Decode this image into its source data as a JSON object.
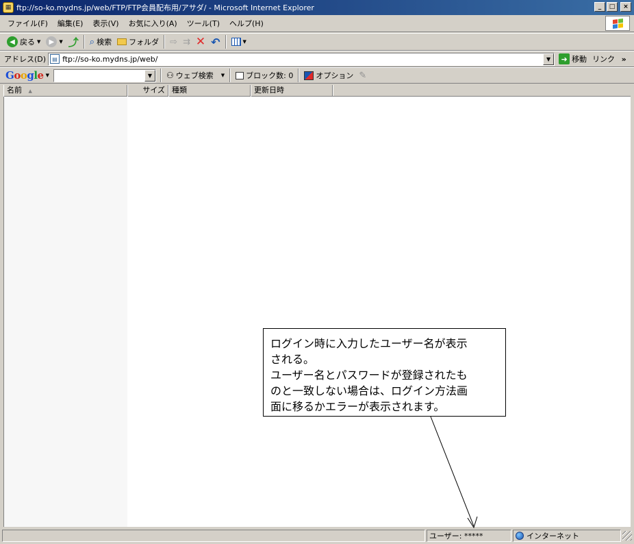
{
  "window": {
    "title": "ftp://so-ko.mydns.jp/web/FTP/FTP会員配布用/アサダ/ - Microsoft Internet Explorer",
    "minimize": "_",
    "maximize": "□",
    "close": "×"
  },
  "menu": {
    "items": [
      {
        "label": "ファイル(F)"
      },
      {
        "label": "編集(E)"
      },
      {
        "label": "表示(V)"
      },
      {
        "label": "お気に入り(A)"
      },
      {
        "label": "ツール(T)"
      },
      {
        "label": "ヘルプ(H)"
      }
    ]
  },
  "toolbar": {
    "back_label": "戻る",
    "search_label": "検索",
    "folders_label": "フォルダ"
  },
  "address": {
    "label": "アドレス(D)",
    "url": "ftp://so-ko.mydns.jp/web/",
    "go_label": "移動",
    "links_label": "リンク",
    "links_chevron": "»"
  },
  "google": {
    "logo": [
      "G",
      "o",
      "o",
      "g",
      "l",
      "e"
    ],
    "search_value": "",
    "web_search_label": "ウェブ検索",
    "popup_block_label": "ブロック数: 0",
    "options_label": "オプション"
  },
  "columns": [
    {
      "label": "名前"
    },
    {
      "label": "サイズ"
    },
    {
      "label": "種類"
    },
    {
      "label": "更新日時"
    }
  ],
  "status": {
    "main": "",
    "user": "ユーザー: *****",
    "zone": "インターネット"
  },
  "callout": {
    "lines": [
      "ログイン時に入力したユーザー名が表示",
      "される。",
      "ユーザー名とパスワードが登録されたも",
      "のと一致しない場合は、ログイン方法画",
      "面に移るかエラーが表示されます。"
    ]
  },
  "colors": {
    "titlebar_start": "#0a246a",
    "titlebar_end": "#3a6ea5",
    "chrome": "#d4d0c8",
    "stop_red": "#e02a2a",
    "go_green": "#2e9e2e"
  }
}
